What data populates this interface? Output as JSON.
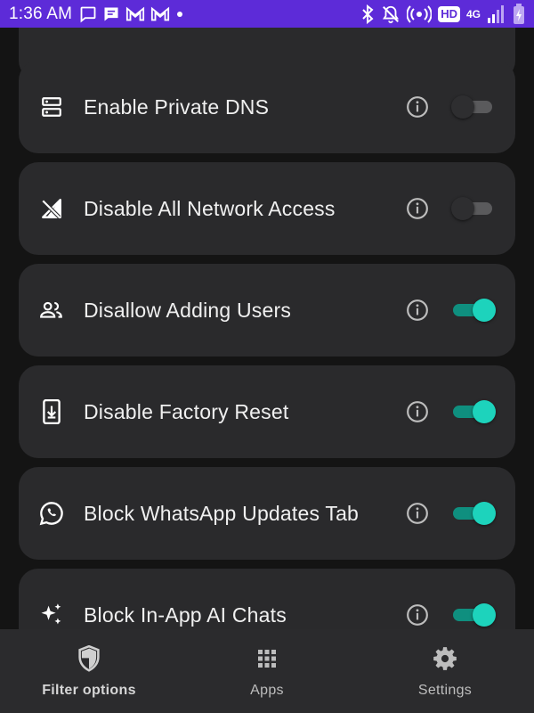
{
  "status_bar": {
    "time": "1:36 AM",
    "hd_badge": "HD",
    "network": "4G",
    "color": "#5d2bd8"
  },
  "settings_list": [
    {
      "label": "Enable Private DNS",
      "icon": "dns-icon",
      "enabled": false
    },
    {
      "label": "Disable All Network Access",
      "icon": "signal-off-icon",
      "enabled": false
    },
    {
      "label": "Disallow Adding Users",
      "icon": "people-icon",
      "enabled": true
    },
    {
      "label": "Disable Factory Reset",
      "icon": "phone-download-icon",
      "enabled": true
    },
    {
      "label": "Block WhatsApp Updates Tab",
      "icon": "whatsapp-icon",
      "enabled": true
    },
    {
      "label": "Block In-App AI Chats",
      "icon": "sparkles-icon",
      "enabled": true
    }
  ],
  "bottom_nav": {
    "items": [
      {
        "label": "Filter options",
        "icon": "shield-icon",
        "active": true
      },
      {
        "label": "Apps",
        "icon": "grid-icon",
        "active": false
      },
      {
        "label": "Settings",
        "icon": "gear-icon",
        "active": false
      }
    ]
  },
  "colors": {
    "background": "#141414",
    "card": "#2a2a2c",
    "toggle_on_track": "#0f8f7f",
    "toggle_on_thumb": "#1dd3bc",
    "toggle_off_track": "#5a5a5c"
  }
}
